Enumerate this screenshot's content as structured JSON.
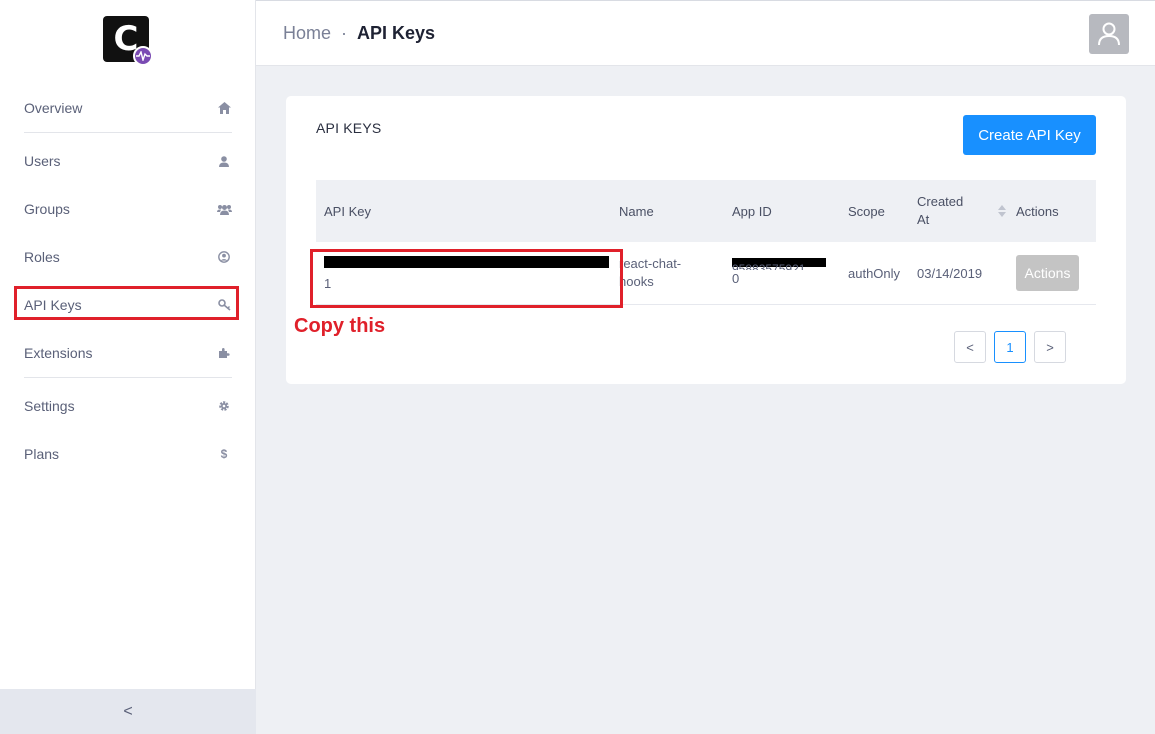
{
  "logo": {
    "letter": "C",
    "badge_color": "#7a4bb3"
  },
  "sidebar": {
    "items": [
      {
        "label": "Overview",
        "icon": "home-icon"
      },
      {
        "label": "Users",
        "icon": "user-icon"
      },
      {
        "label": "Groups",
        "icon": "users-icon"
      },
      {
        "label": "Roles",
        "icon": "user-circle-icon"
      },
      {
        "label": "API Keys",
        "icon": "key-icon"
      },
      {
        "label": "Extensions",
        "icon": "puzzle-icon"
      },
      {
        "label": "Settings",
        "icon": "gear-icon"
      },
      {
        "label": "Plans",
        "icon": "dollar-icon"
      }
    ],
    "collapse_label": "<"
  },
  "header": {
    "breadcrumb_home": "Home",
    "breadcrumb_sep": "·",
    "breadcrumb_current": "API Keys"
  },
  "card": {
    "title": "API KEYS",
    "create_button": "Create API Key",
    "columns": {
      "api_key": "API Key",
      "name": "Name",
      "app_id": "App ID",
      "scope": "Scope",
      "created_at_line1": "Created",
      "created_at_line2": "At",
      "actions": "Actions"
    },
    "rows": [
      {
        "api_key_tail": "1",
        "name_line1": "react-chat-",
        "name_line2": "hooks",
        "app_id_line1": "95883575921",
        "app_id_line2": "0",
        "scope": "authOnly",
        "created_at": "03/14/2019",
        "action_label": "Actions"
      }
    ]
  },
  "annotation": {
    "note": "Copy this",
    "color": "#e0202a"
  },
  "pagination": {
    "prev": "<",
    "current": "1",
    "next": ">"
  },
  "colors": {
    "primary": "#1890ff",
    "action_disabled": "#c4c4c4"
  }
}
